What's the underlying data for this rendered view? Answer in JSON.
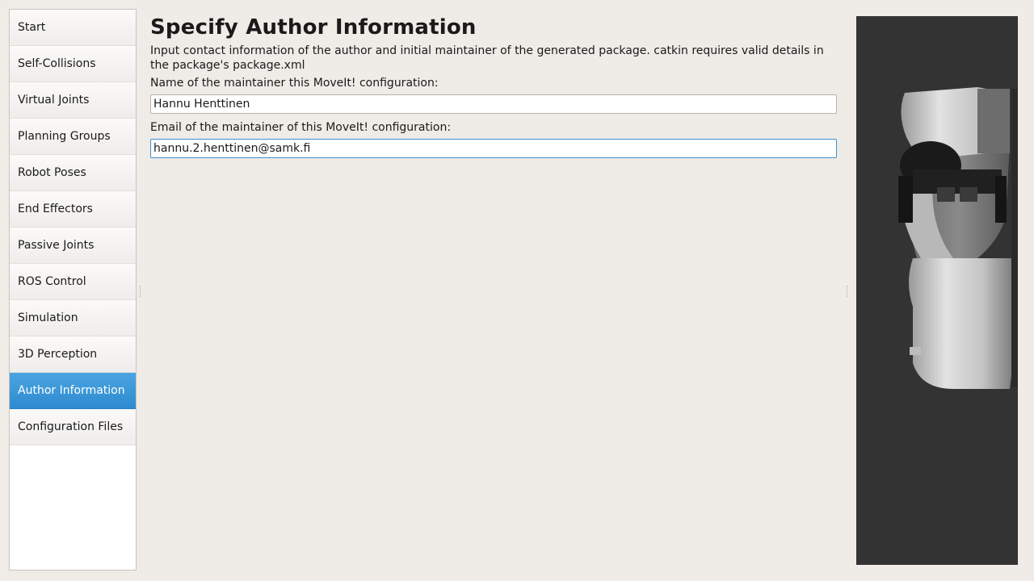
{
  "sidebar": {
    "items": [
      {
        "label": "Start",
        "active": false
      },
      {
        "label": "Self-Collisions",
        "active": false
      },
      {
        "label": "Virtual Joints",
        "active": false
      },
      {
        "label": "Planning Groups",
        "active": false
      },
      {
        "label": "Robot Poses",
        "active": false
      },
      {
        "label": "End Effectors",
        "active": false
      },
      {
        "label": "Passive Joints",
        "active": false
      },
      {
        "label": "ROS Control",
        "active": false
      },
      {
        "label": "Simulation",
        "active": false
      },
      {
        "label": "3D Perception",
        "active": false
      },
      {
        "label": "Author Information",
        "active": true
      },
      {
        "label": "Configuration Files",
        "active": false
      }
    ]
  },
  "main": {
    "title": "Specify Author Information",
    "description": "Input contact information of the author and initial maintainer of the generated package. catkin requires valid details in the package's package.xml",
    "name_label": "Name of the maintainer this MoveIt! configuration:",
    "name_value": "Hannu Henttinen",
    "email_label": "Email of the maintainer of this MoveIt! configuration:",
    "email_value": "hannu.2.henttinen@samk.fi"
  },
  "colors": {
    "background": "#efebe7",
    "accent": "#3d8fd0",
    "viewport": "#333333"
  }
}
